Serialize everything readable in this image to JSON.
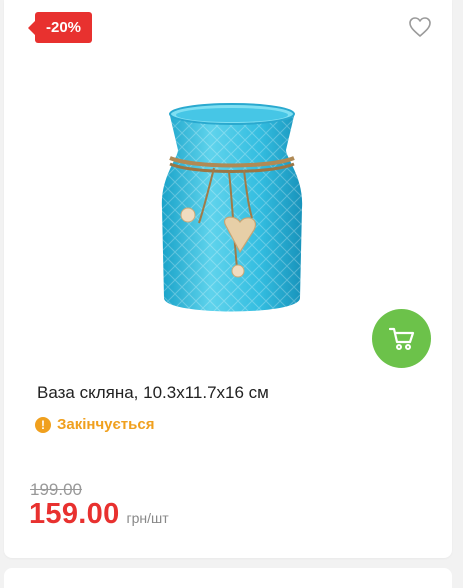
{
  "product": {
    "discount_badge": "-20%",
    "title": "Ваза скляна, 10.3x11.7x16 см",
    "stock_status": "Закінчується",
    "old_price": "199.00",
    "price": "159.00",
    "unit": "грн/шт"
  },
  "icons": {
    "wishlist": "heart-icon",
    "cart": "cart-icon",
    "stock": "exclamation-icon"
  },
  "colors": {
    "accent_red": "#e8312f",
    "cart_green": "#6cc24a",
    "warning_orange": "#f0a01e"
  }
}
